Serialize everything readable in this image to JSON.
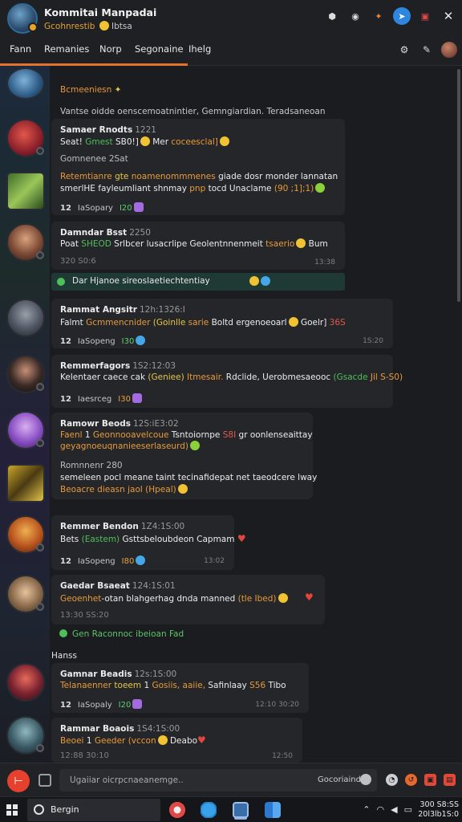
{
  "window": {
    "title": "Kommitai Manpadai",
    "subtitle": "Gcohnrestib",
    "subtitle_b": "Ibtsa"
  },
  "titlebar_icons": [
    "settings-icon",
    "search-icon",
    "pin-icon",
    "messenger-icon",
    "record-icon",
    "close-icon"
  ],
  "tabs": [
    {
      "label": "Fann"
    },
    {
      "label": "Remanies"
    },
    {
      "label": "Norp"
    },
    {
      "label": "Segonaine"
    },
    {
      "label": "Ihelg"
    }
  ],
  "system": {
    "pinned": "Bcmeeniesn",
    "info": "Vantse oidde oenscemoatnintier, Gemngiardian. Teradsaneoan",
    "notice": "Dar Hjanoe sireoslaetiechtentiay",
    "green_event": "Gen Raconnoc ibeioan Fad",
    "section": "Hanss"
  },
  "messages": [
    {
      "name": "Samaer Rnodts",
      "time": "1221",
      "l1a": "Seat!",
      "l1b": "Gmest",
      "l1c": "SB0!]",
      "l1d": "Mer",
      "l1e": "coceesclal]",
      "l2": "Gomnenee 2Sat",
      "l3a": "Retemtianre",
      "l3b": "gte",
      "l3c": "noamenommmenes",
      "l3d": "giade dosr",
      "l3e": "monder lannatan",
      "l4a": "smerlHE",
      "l4b": "fayleumliant shnmay",
      "l4c": "pnp",
      "l4d": "tocd Unaclame",
      "l4e": "(90 ;1];1)",
      "count": "12",
      "react": "IaSopary",
      "react_n": "I20"
    },
    {
      "name": "Damndar Bsst",
      "time": "2250",
      "l1a": "Poat",
      "l1b": "SHEOD",
      "l1c": "Srlbcer lusacrlipe",
      "l1d": "Geolentnnenmeit",
      "l1e": "tsaerio",
      "l1f": "Bum",
      "stamp_l": "320 S0:6",
      "stamp_r": "13:38"
    },
    {
      "name": "Rammat Angsitr",
      "time": "12h:1326:I",
      "l1a": "Falmt",
      "l1b": "Gcmmencnider",
      "l1c": "(Goinlle",
      "l1d": "sarie",
      "l1e": "Boltd",
      "l1f": "ergenoeoarl",
      "l1g": "Goelr]",
      "l1h": "36S",
      "count": "12",
      "react": "IaSopeng",
      "react_n": "I30",
      "stamp": "1S:20"
    },
    {
      "name": "Remmerfagors",
      "time": "1S2:12:03",
      "l1a": "Kelentaer caece cak",
      "l1b": "(Geniee)",
      "l1c": "Itmesair.",
      "l1d": "Rdclide, Uerobmesaeooc",
      "l1e": "(Gsacde",
      "l1f": "Jil S-S0)",
      "count": "12",
      "react": "Iaesrceg",
      "react_n": "I30"
    },
    {
      "name": "Ramowr Beods",
      "time": "12S:iE3:02",
      "l1a": "Faenl",
      "l1b": "1",
      "l1c": "Geonnooavelcoue",
      "l1d": "Tsntoiornpe",
      "l1e": "S8I",
      "l1f": "gr oonlenseaittay",
      "l2": "geyagnoeuqnanieeserlaseurd)",
      "l3": "Romnnenr 280",
      "l4a": "semeleen pocl meane taint",
      "l4b": "tecinafidepat",
      "l4c": "net taeodcere lway",
      "l5": "Beoacre dieasn jaol (Hpeal)"
    },
    {
      "name": "Remmer Bendon",
      "time": "1Z4:1S:00",
      "l1a": "Bets",
      "l1b": "(Eastem)",
      "l1c": "Gsttsbeloubdeon Capmam",
      "count": "12",
      "react": "IaSopeng",
      "react_n": "I80",
      "stamp": "13:02"
    },
    {
      "name": "Gaedar Bsaeat",
      "time": "124:1S:01",
      "l1a": "Geoenhet",
      "l1b": "-otan",
      "l1c": "blahgerhag",
      "l1d": "dnda",
      "l1e": "manned",
      "l1f": "(tle Ibed)",
      "stamp": "13:30 SS:20"
    },
    {
      "name": "Gamnar Beadis",
      "time": "12s:1S:00",
      "l1a": "Telanaenner",
      "l1b": "toeem",
      "l1c": "1",
      "l1d": "Gosiis,",
      "l1e": "aaiie,",
      "l1f": "Safinlaay",
      "l1g": "S56",
      "l1h": "Tibo",
      "count": "12",
      "react": "IaSopaly",
      "react_n": "I20",
      "stamp": "12:10 30:20"
    },
    {
      "name": "Rammar Boaois",
      "time": "1S4:1S:00",
      "l1a": "Beoei",
      "l1b": "1",
      "l1c": "Geeder",
      "l1d": "(vccon",
      "l1e": "Deabo",
      "stamp_l": "12:88 30:10",
      "stamp_r": "12:50"
    }
  ],
  "input": {
    "placeholder": "Ugaiiar oicrpcnaeanemge..",
    "send_label": "Gocoriaind"
  },
  "taskbar": {
    "search_label": "Bergin",
    "time": "300 S8:SS",
    "date": "20l3lb1S:0"
  },
  "colors": {
    "accent": "#e4732d",
    "background": "#1b1c1f",
    "bubble": "#25262a",
    "green_text": "#4fbf5a",
    "orange_text": "#e89a38",
    "notice_bg": "#1f3a34"
  }
}
